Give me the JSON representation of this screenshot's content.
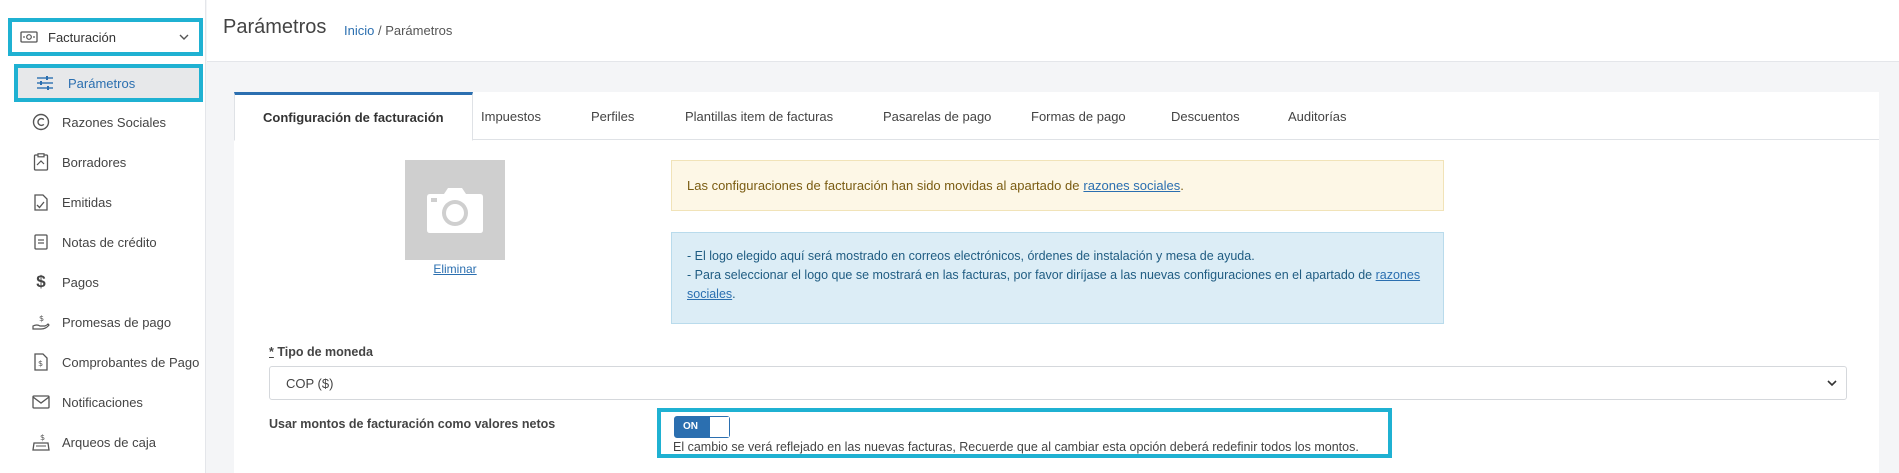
{
  "sidebar": {
    "group_label": "Facturación",
    "active_label": "Parámetros",
    "items": [
      {
        "label": "Razones Sociales",
        "icon": "copyright-icon"
      },
      {
        "label": "Borradores",
        "icon": "draft-icon"
      },
      {
        "label": "Emitidas",
        "icon": "issued-icon"
      },
      {
        "label": "Notas de crédito",
        "icon": "credit-note-icon"
      },
      {
        "label": "Pagos",
        "icon": "dollar-icon"
      },
      {
        "label": "Promesas de pago",
        "icon": "hand-coin-icon"
      },
      {
        "label": "Comprobantes de Pago",
        "icon": "receipt-icon"
      },
      {
        "label": "Notificaciones",
        "icon": "mail-icon"
      },
      {
        "label": "Arqueos de caja",
        "icon": "cash-register-icon"
      }
    ]
  },
  "header": {
    "title": "Parámetros",
    "breadcrumb_home": "Inicio",
    "breadcrumb_sep": " / ",
    "breadcrumb_current": "Parámetros"
  },
  "tabs": [
    "Configuración de facturación",
    "Impuestos",
    "Perfiles",
    "Plantillas item de facturas",
    "Pasarelas de pago",
    "Formas de pago",
    "Descuentos",
    "Auditorías"
  ],
  "logo": {
    "delete_label": "Eliminar"
  },
  "alerts": {
    "warning_text": "Las configuraciones de facturación han sido movidas al apartado de ",
    "warning_link": "razones sociales",
    "warning_end": ".",
    "info_line1": "- El logo elegido aquí será mostrado en correos electrónicos, órdenes de instalación y mesa de ayuda.",
    "info_line2": "- Para seleccionar el logo que se mostrará en las facturas, por favor diríjase a las nuevas configuraciones en el apartado de",
    "info_link": "razones sociales",
    "info_end": "."
  },
  "form": {
    "required_mark": "*",
    "currency_label": " Tipo de moneda",
    "currency_value": "COP ($)",
    "net_label": "Usar montos de facturación como valores netos",
    "toggle_label": "ON",
    "net_help": "El cambio se verá reflejado en las nuevas facturas, Recuerde que al cambiar esta opción deberá redefinir todos los montos."
  },
  "colors": {
    "accent": "#2b6fb0",
    "highlight": "#1fb1d2"
  }
}
